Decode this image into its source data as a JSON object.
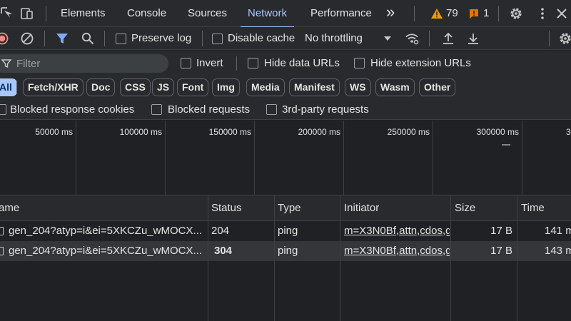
{
  "tabs": [
    {
      "label": "Elements"
    },
    {
      "label": "Console"
    },
    {
      "label": "Sources"
    },
    {
      "label": "Network",
      "active": true
    },
    {
      "label": "Performance"
    }
  ],
  "more_tabs_label": "»",
  "warnings_count": "79",
  "issues_count": "1",
  "toolbar": {
    "preserve_log_label": "Preserve log",
    "disable_cache_label": "Disable cache",
    "throttling_value": "No throttling"
  },
  "filter": {
    "placeholder": "Filter",
    "invert_label": "Invert",
    "hide_data_urls_label": "Hide data URLs",
    "hide_extension_urls_label": "Hide extension URLs"
  },
  "type_filters": [
    "All",
    "Fetch/XHR",
    "Doc",
    "CSS",
    "JS",
    "Font",
    "Img",
    "Media",
    "Manifest",
    "WS",
    "Wasm",
    "Other"
  ],
  "blocked": {
    "response_cookies_label": "Blocked response cookies",
    "requests_label": "Blocked requests",
    "third_party_label": "3rd-party requests"
  },
  "overview_ticks": [
    "50000 ms",
    "100000 ms",
    "150000 ms",
    "200000 ms",
    "250000 ms",
    "300000 ms",
    "3"
  ],
  "columns": [
    "ame",
    "Status",
    "Type",
    "Initiator",
    "Size",
    "Time"
  ],
  "rows": [
    {
      "name": "gen_204?atyp=i&ei=5XKCZu_wMOCX...",
      "status": "204",
      "type": "ping",
      "initiator": "m=X3N0Bf,attn,cdos,g",
      "size": "17 B",
      "time": "141 m"
    },
    {
      "name": "gen_204?atyp=i&ei=5XKCZu_wMOCX...",
      "status": "304",
      "type": "ping",
      "initiator": "m=X3N0Bf,attn,cdos,g",
      "size": "17 B",
      "time": "143 m"
    }
  ],
  "colors": {
    "accent": "#a8c7fa",
    "record": "#f28b82",
    "filter_active": "#7cacf8",
    "warning": "#f29900",
    "issue": "#e37400"
  }
}
